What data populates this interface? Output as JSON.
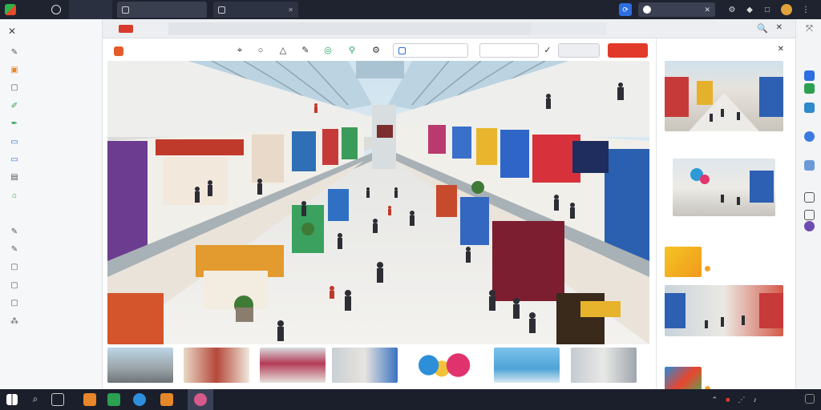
{
  "titlebar": {
    "app_name": "",
    "file_label": "",
    "tabs": [
      {
        "label": ""
      },
      {
        "label": ""
      }
    ],
    "search_placeholder": ""
  },
  "sidebar": {
    "header": "",
    "items": [
      {
        "label": "",
        "icon": "pencil-icon",
        "color": "#555555"
      },
      {
        "label": "",
        "icon": "folder-icon",
        "color": "#e8862a"
      },
      {
        "label": "",
        "icon": "square-icon",
        "color": "#555555"
      },
      {
        "label": "",
        "icon": "edit-icon",
        "color": "#2aa050"
      },
      {
        "label": "",
        "icon": "pen-icon",
        "color": "#2aa050"
      },
      {
        "label": "",
        "icon": "window-icon",
        "color": "#2d6ecc"
      },
      {
        "label": "",
        "icon": "window-icon",
        "color": "#2d6ecc"
      },
      {
        "label": "",
        "icon": "monitor-icon",
        "color": "#555555"
      },
      {
        "label": "",
        "icon": "home-icon",
        "color": "#2aa050"
      },
      {
        "label": "",
        "icon": "blank-icon",
        "color": "#555555"
      },
      {
        "label": "",
        "icon": "pencil-icon",
        "color": "#555555"
      },
      {
        "label": "",
        "icon": "pencil-icon",
        "color": "#555555"
      },
      {
        "label": "",
        "icon": "box-icon",
        "color": "#555555"
      },
      {
        "label": "",
        "icon": "box-icon",
        "color": "#555555"
      },
      {
        "label": "",
        "icon": "box-icon",
        "color": "#555555"
      },
      {
        "label": "",
        "icon": "network-icon",
        "color": "#555555"
      }
    ]
  },
  "subbar": {
    "label": "",
    "tab_label": "",
    "tab2_label": ""
  },
  "toolbar": {
    "title": "",
    "tools": [
      "cursor-icon",
      "circle-icon",
      "triangle-icon",
      "pen-icon",
      "pin-icon",
      "link-icon",
      "gear-icon"
    ],
    "dropdown_label": "",
    "share_label": "",
    "publish_label": ""
  },
  "hero": {
    "description_icon": "mall-interior-photo"
  },
  "right_panel": {
    "title": "",
    "cards": [
      {
        "caption": ""
      },
      {
        "caption": ""
      }
    ],
    "small_cards": [
      {
        "title": "",
        "meta": ""
      },
      {
        "title": "",
        "meta": ""
      },
      {
        "title": "",
        "meta": ""
      }
    ]
  },
  "taskbar": {
    "time": "",
    "date": ""
  },
  "colors": {
    "accent_red": "#e23a2a",
    "accent_blue": "#2d6ee0",
    "titlebar_bg": "#1f2330",
    "taskbar_bg": "#1b1f2b"
  }
}
